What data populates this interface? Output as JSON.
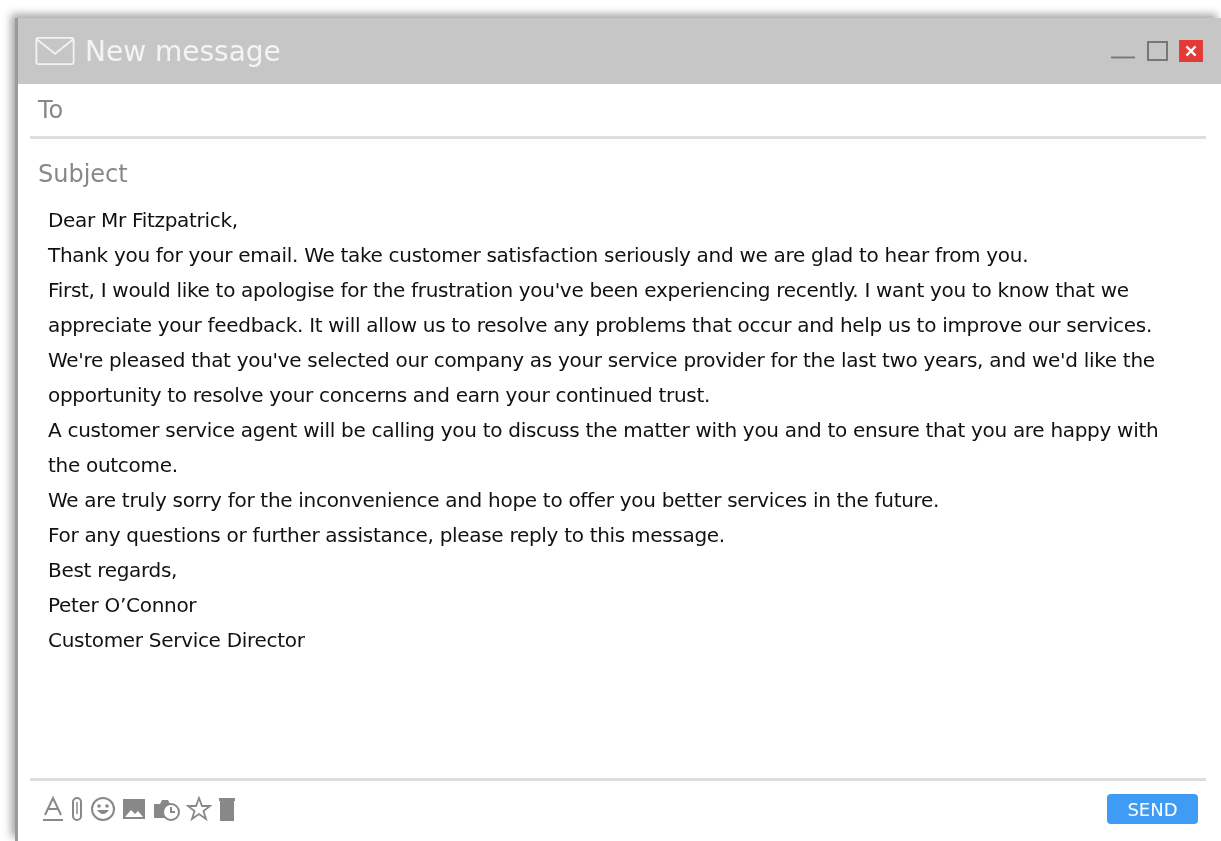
{
  "window": {
    "title": "New message"
  },
  "to": {
    "placeholder": "To"
  },
  "subject": {
    "placeholder": "Subject"
  },
  "body": [
    "Dear Mr Fitzpatrick,",
    "Thank you for your email. We take customer satisfaction seriously and we are glad to hear from you.",
    "First, I would like to apologise for the frustration you've been experiencing recently. I want you to know that we appreciate your feedback. It will allow us to resolve any problems that occur and help us to improve our services.",
    "We're pleased that you've selected our company as your service provider for the last two years, and we'd like the opportunity to resolve your concerns and earn your continued trust.",
    "A customer service agent will be calling you to discuss the matter with you and to ensure that you are happy with the outcome.",
    "We are truly sorry for the inconvenience and hope to offer you better services in the future.",
    "For any questions or further assistance, please reply to this message.",
    "Best regards,",
    "Peter O’Connor",
    "Customer Service Director"
  ],
  "send_button": "SEND"
}
